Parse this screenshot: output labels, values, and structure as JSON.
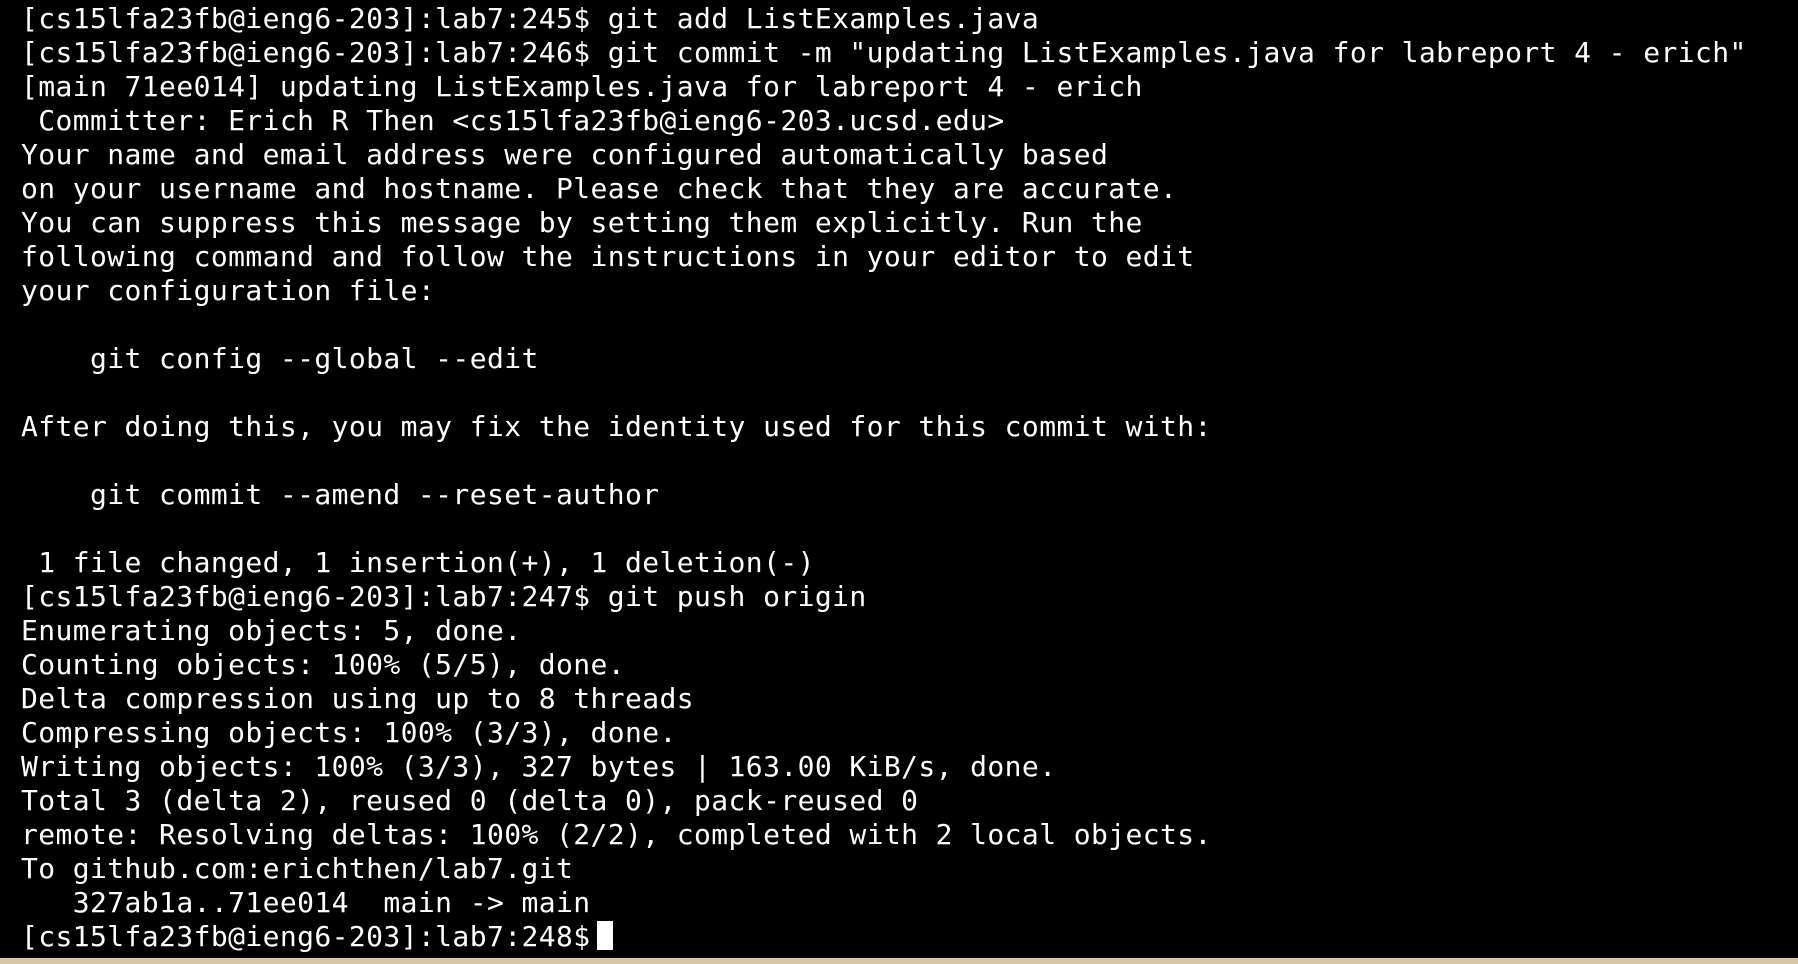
{
  "terminal": {
    "lines": [
      "[cs15lfa23fb@ieng6-203]:lab7:245$ git add ListExamples.java",
      "[cs15lfa23fb@ieng6-203]:lab7:246$ git commit -m \"updating ListExamples.java for labreport 4 - erich\"",
      "[main 71ee014] updating ListExamples.java for labreport 4 - erich",
      " Committer: Erich R Then <cs15lfa23fb@ieng6-203.ucsd.edu>",
      "Your name and email address were configured automatically based",
      "on your username and hostname. Please check that they are accurate.",
      "You can suppress this message by setting them explicitly. Run the",
      "following command and follow the instructions in your editor to edit",
      "your configuration file:",
      "",
      "    git config --global --edit",
      "",
      "After doing this, you may fix the identity used for this commit with:",
      "",
      "    git commit --amend --reset-author",
      "",
      " 1 file changed, 1 insertion(+), 1 deletion(-)",
      "[cs15lfa23fb@ieng6-203]:lab7:247$ git push origin",
      "Enumerating objects: 5, done.",
      "Counting objects: 100% (5/5), done.",
      "Delta compression using up to 8 threads",
      "Compressing objects: 100% (3/3), done.",
      "Writing objects: 100% (3/3), 327 bytes | 163.00 KiB/s, done.",
      "Total 3 (delta 2), reused 0 (delta 0), pack-reused 0",
      "remote: Resolving deltas: 100% (2/2), completed with 2 local objects.",
      "To github.com:erichthen/lab7.git",
      "   327ab1a..71ee014  main -> main"
    ],
    "prompt": "[cs15lfa23fb@ieng6-203]:lab7:248$"
  },
  "colors": {
    "background": "#000000",
    "text": "#ffffff",
    "border": "#d8c5a5"
  }
}
